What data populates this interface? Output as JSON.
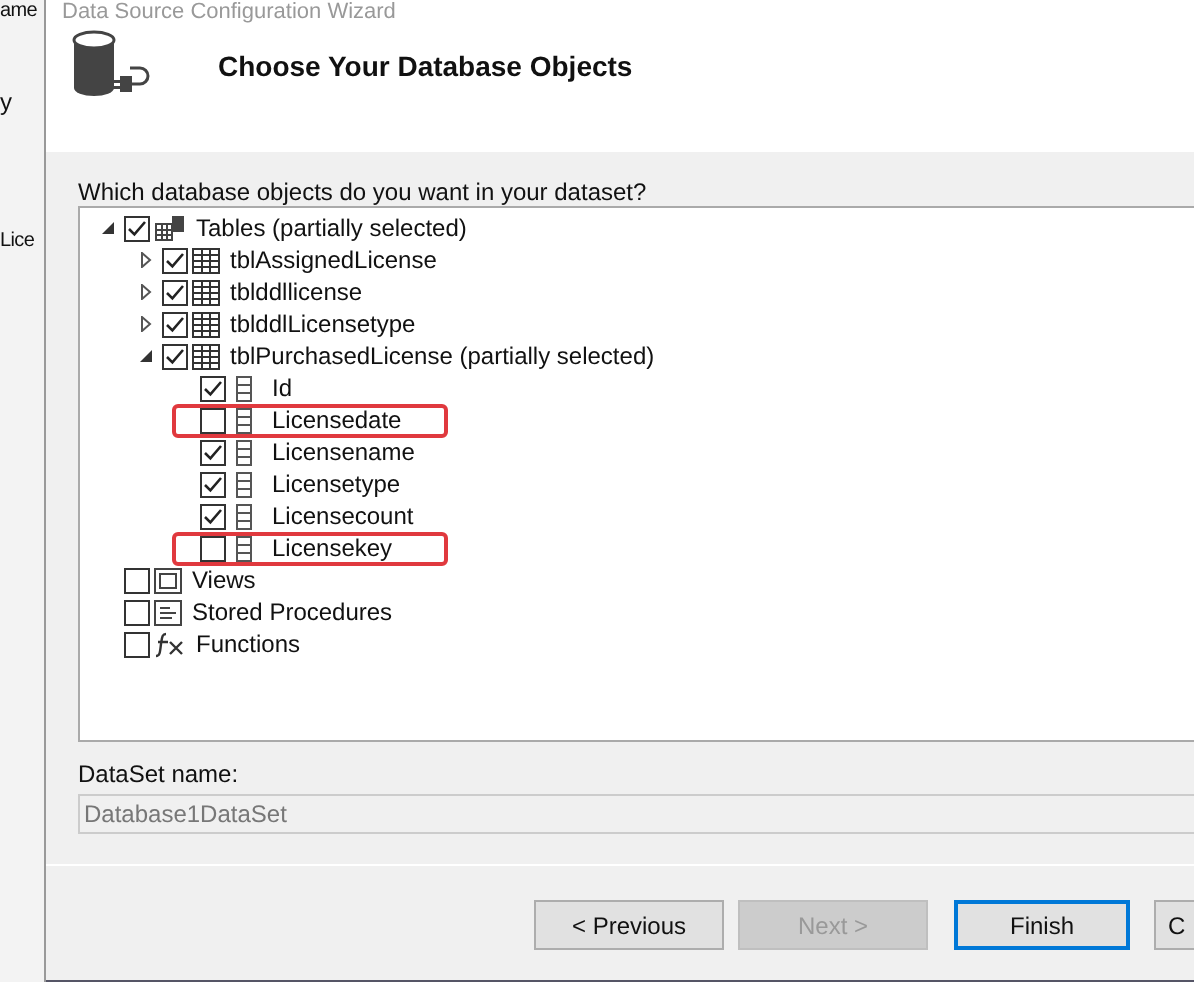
{
  "background_window": {
    "texts": [
      "ame",
      "y",
      "Lice"
    ]
  },
  "window": {
    "title": "Data Source Configuration Wizard"
  },
  "header": {
    "title": "Choose Your Database Objects"
  },
  "prompt": "Which database objects do you want in your dataset?",
  "tree": [
    {
      "kind": "tables",
      "label": "Tables (partially selected)",
      "checked": true,
      "expanded": true,
      "highlighted": false,
      "children": [
        {
          "kind": "table",
          "label": "tblAssignedLicense",
          "checked": true,
          "expanded": false,
          "highlighted": false
        },
        {
          "kind": "table",
          "label": "tblddllicense",
          "checked": true,
          "expanded": false,
          "highlighted": false
        },
        {
          "kind": "table",
          "label": "tblddlLicensetype",
          "checked": true,
          "expanded": false,
          "highlighted": false
        },
        {
          "kind": "table",
          "label": "tblPurchasedLicense (partially selected)",
          "checked": true,
          "expanded": true,
          "highlighted": false,
          "children": [
            {
              "kind": "column",
              "label": "Id",
              "checked": true,
              "highlighted": false
            },
            {
              "kind": "column",
              "label": "Licensedate",
              "checked": false,
              "highlighted": true
            },
            {
              "kind": "column",
              "label": "Licensename",
              "checked": true,
              "highlighted": false
            },
            {
              "kind": "column",
              "label": "Licensetype",
              "checked": true,
              "highlighted": false
            },
            {
              "kind": "column",
              "label": "Licensecount",
              "checked": true,
              "highlighted": false
            },
            {
              "kind": "column",
              "label": "Licensekey",
              "checked": false,
              "highlighted": true
            }
          ]
        }
      ]
    },
    {
      "kind": "views",
      "label": "Views",
      "checked": false,
      "highlighted": false
    },
    {
      "kind": "procedures",
      "label": "Stored Procedures",
      "checked": false,
      "highlighted": false
    },
    {
      "kind": "functions",
      "label": "Functions",
      "checked": false,
      "highlighted": false
    }
  ],
  "dataset": {
    "label": "DataSet name:",
    "value": "Database1DataSet",
    "disabled": true
  },
  "buttons": [
    {
      "label": "< Previous",
      "disabled": false,
      "selected": false
    },
    {
      "label": "Next >",
      "disabled": true,
      "selected": false
    },
    {
      "label": "Finish",
      "disabled": false,
      "selected": true
    },
    {
      "label": "C",
      "disabled": false,
      "selected": false
    }
  ]
}
